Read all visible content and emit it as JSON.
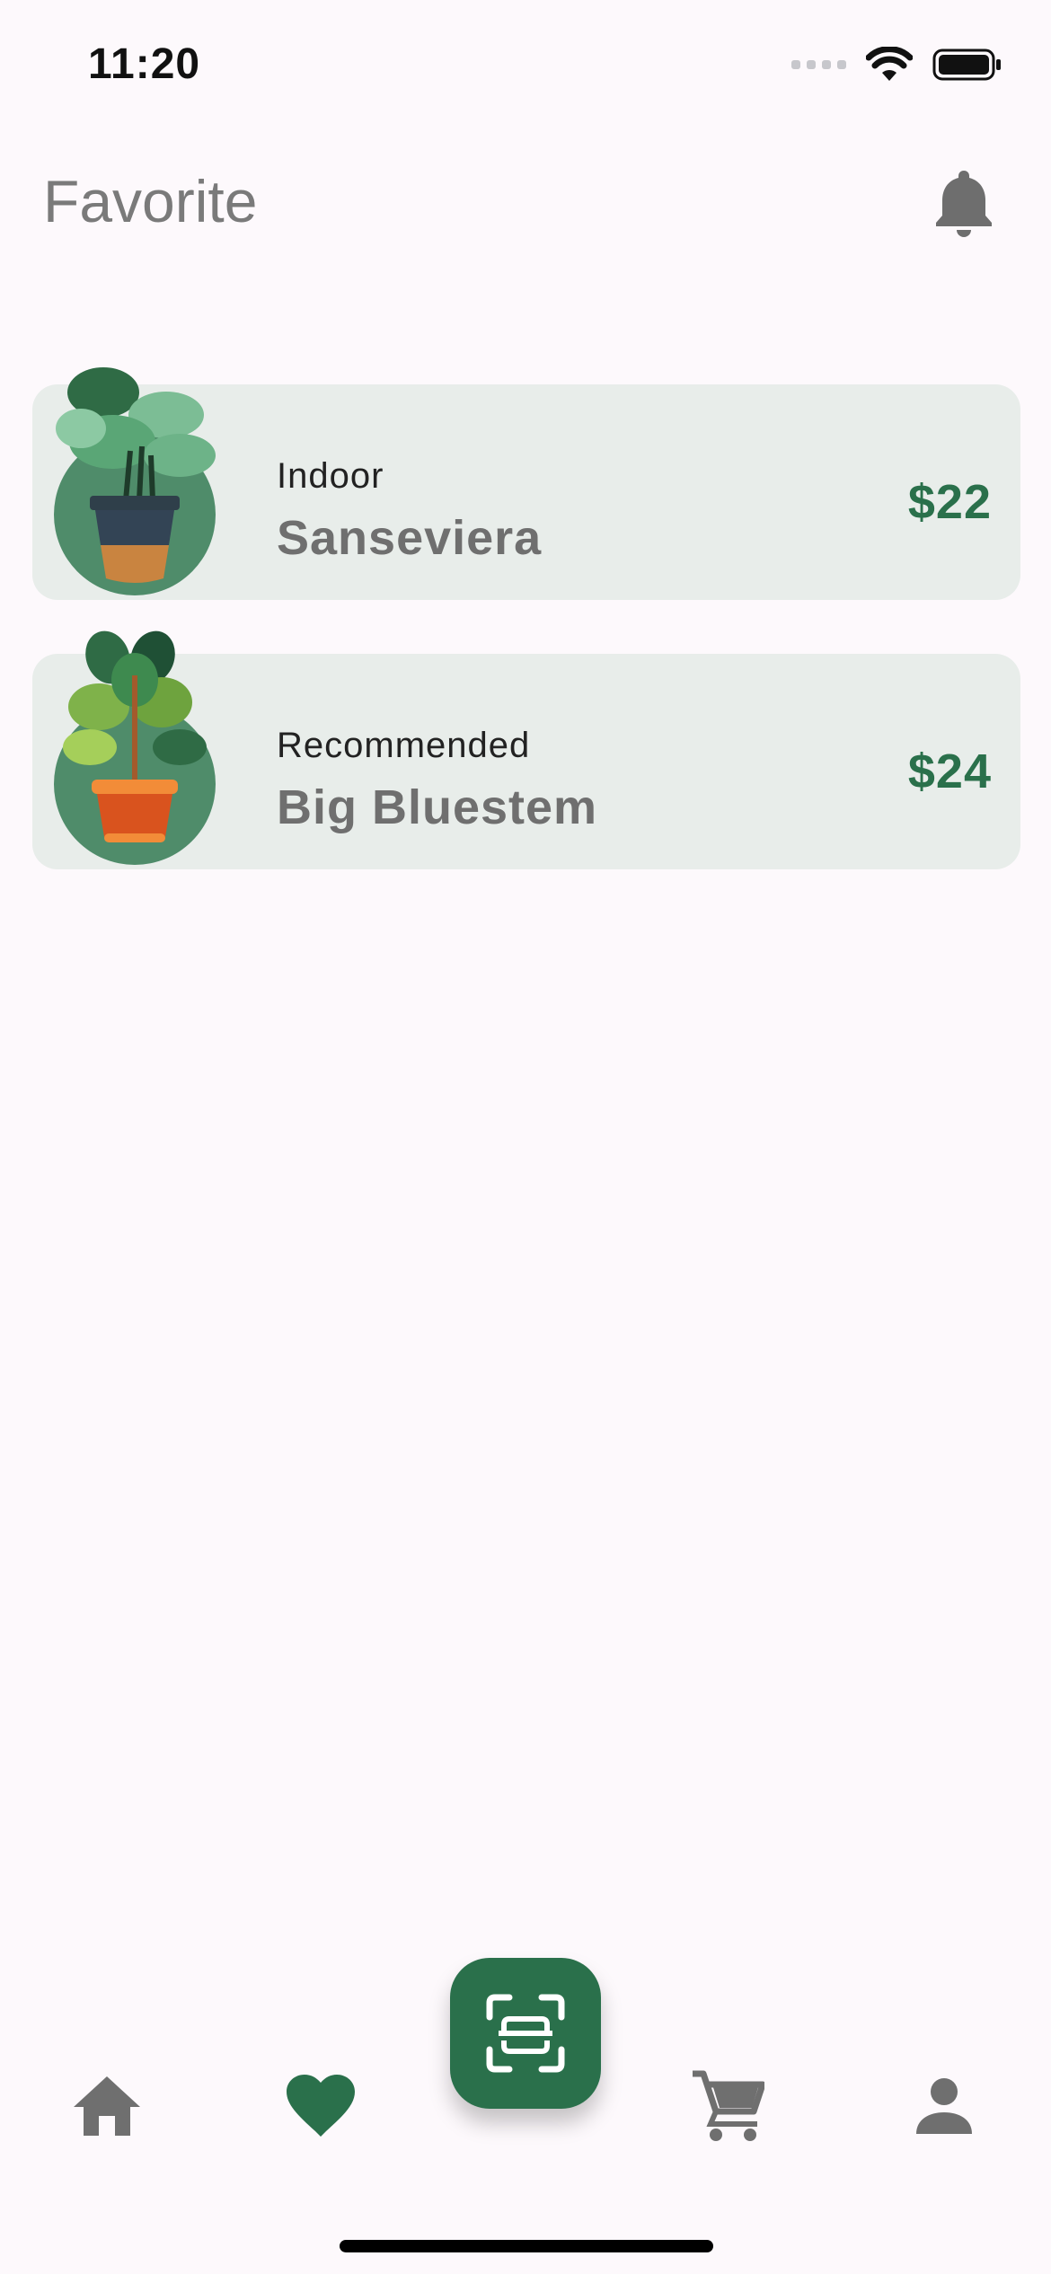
{
  "status_bar": {
    "time": "11:20"
  },
  "header": {
    "title": "Favorite",
    "bell_icon": "bell-icon"
  },
  "favorites": [
    {
      "category": "Indoor",
      "name": "Sanseviera",
      "price": "$22",
      "image_icon": "potted-plant-dark-pot"
    },
    {
      "category": "Recommended",
      "name": "Big Bluestem",
      "price": "$24",
      "image_icon": "potted-plant-orange-pot"
    }
  ],
  "bottom_nav": {
    "items": [
      {
        "icon": "home-icon",
        "active": false
      },
      {
        "icon": "heart-icon",
        "active": true
      },
      {
        "icon": "scan-icon",
        "active": false
      },
      {
        "icon": "cart-icon",
        "active": false
      },
      {
        "icon": "person-icon",
        "active": false
      }
    ]
  },
  "colors": {
    "accent": "#2a704b",
    "card_bg": "#e8edea",
    "inactive_icon": "#6f6f6f",
    "background": "#fdf9fc"
  }
}
